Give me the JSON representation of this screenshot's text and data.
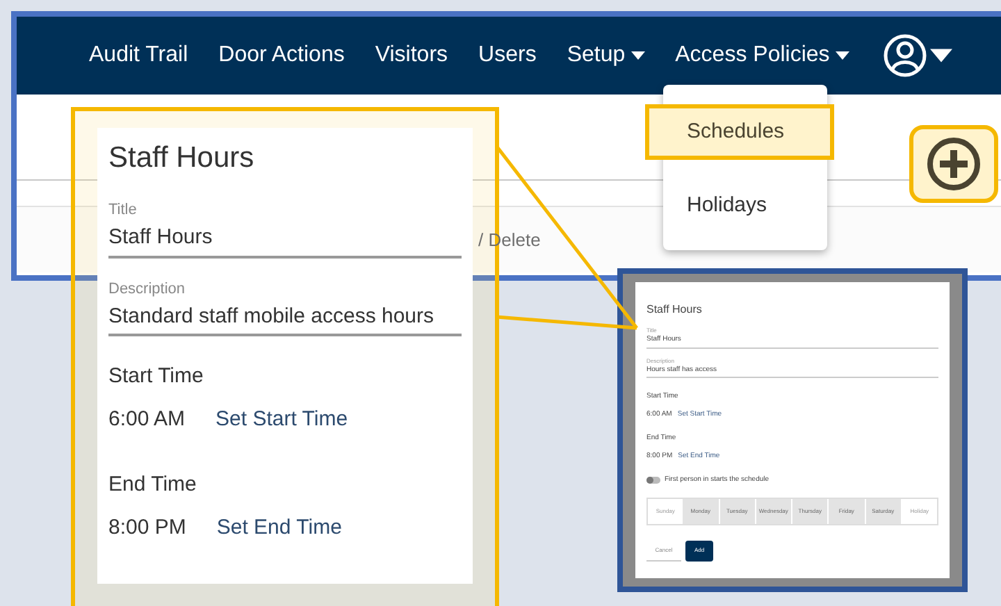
{
  "nav": {
    "items": [
      {
        "label": "Audit Trail",
        "kind": "link"
      },
      {
        "label": "Door Actions",
        "kind": "link"
      },
      {
        "label": "Visitors",
        "kind": "link"
      },
      {
        "label": "Users",
        "kind": "link"
      },
      {
        "label": "Setup",
        "kind": "dropdown"
      },
      {
        "label": "Access Policies",
        "kind": "dropdown"
      }
    ]
  },
  "menu": {
    "items": [
      {
        "label": "Schedules",
        "selected": true
      },
      {
        "label": "Holidays",
        "selected": false
      }
    ]
  },
  "toolbar": {
    "action": "/ Delete"
  },
  "callout": {
    "title": "Staff Hours",
    "fields": [
      {
        "label": "Title",
        "value": "Staff Hours"
      },
      {
        "label": "Description",
        "value": "Standard staff mobile access hours"
      }
    ],
    "times": [
      {
        "label": "Start Time",
        "value": "6:00 AM",
        "action": "Set Start Time"
      },
      {
        "label": "End Time",
        "value": "8:00 PM",
        "action": "Set End Time"
      }
    ]
  },
  "dialog": {
    "title": "Staff Hours",
    "fields": [
      {
        "label": "Title",
        "value": "Staff Hours"
      },
      {
        "label": "Description",
        "value": "Hours staff has access"
      }
    ],
    "times": [
      {
        "label": "Start Time",
        "value": "6:00 AM",
        "action": "Set Start Time"
      },
      {
        "label": "End Time",
        "value": "8:00 PM",
        "action": "Set End Time"
      }
    ],
    "toggle": {
      "label": "First person in starts the schedule",
      "on": false
    },
    "days": [
      {
        "label": "Sunday",
        "selected": false
      },
      {
        "label": "Monday",
        "selected": true
      },
      {
        "label": "Tuesday",
        "selected": true
      },
      {
        "label": "Wednesday",
        "selected": true
      },
      {
        "label": "Thursday",
        "selected": true
      },
      {
        "label": "Friday",
        "selected": true
      },
      {
        "label": "Saturday",
        "selected": true
      },
      {
        "label": "Holiday",
        "selected": false
      }
    ],
    "buttons": [
      {
        "label": "Cancel",
        "kind": "secondary"
      },
      {
        "label": "Add",
        "kind": "primary"
      }
    ]
  }
}
